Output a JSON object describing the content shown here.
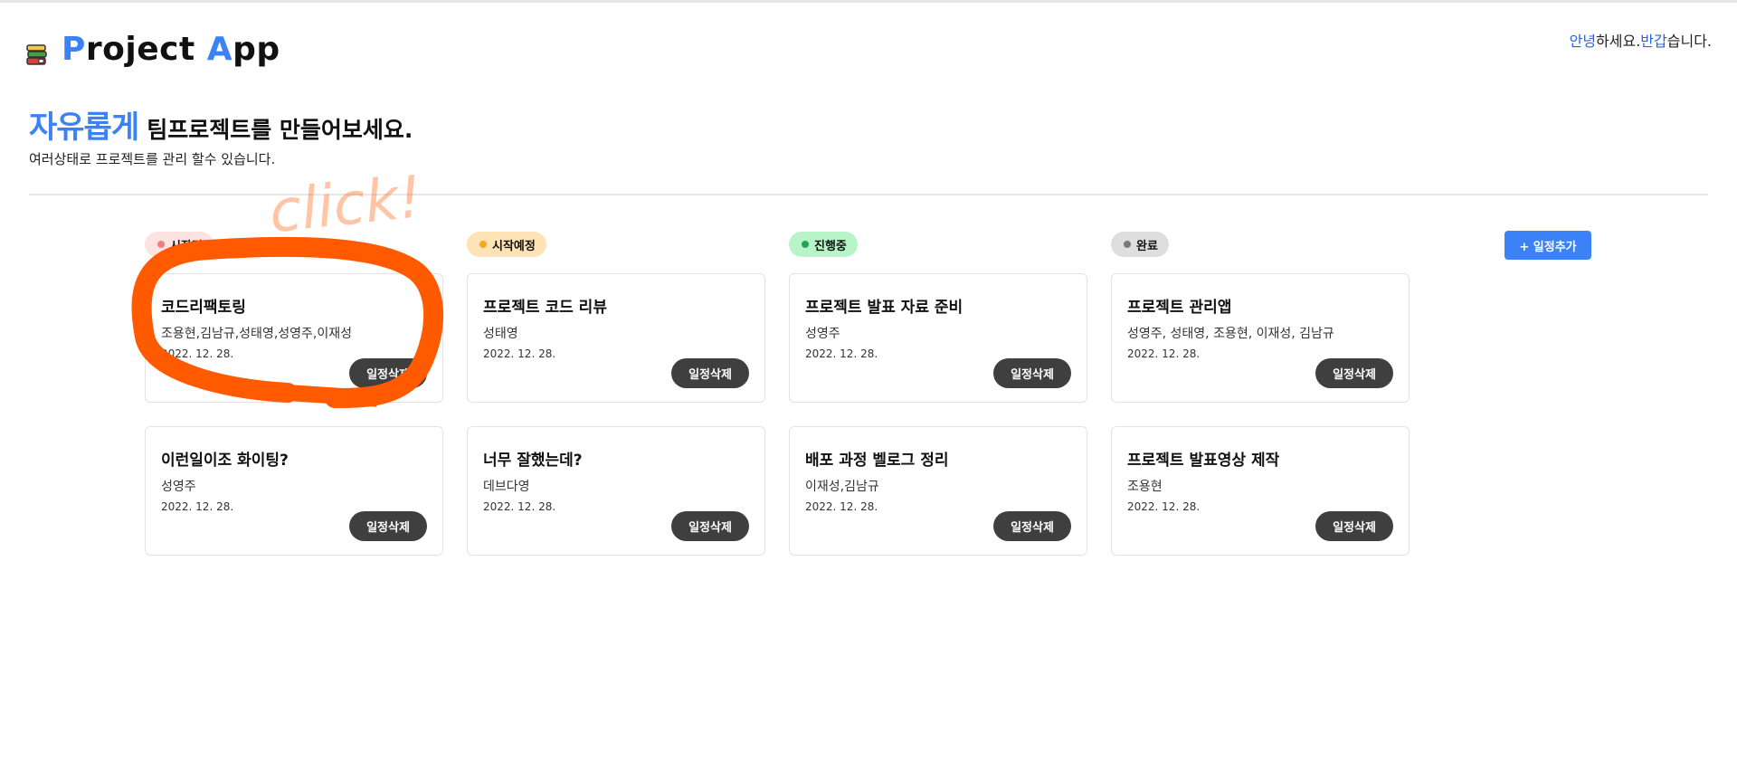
{
  "app": {
    "logo_prefix_accent": "P",
    "logo_part1": "roject ",
    "logo_accent2": "A",
    "logo_part2": "pp"
  },
  "header": {
    "greeting_hl1": "안녕",
    "greeting_t1": "하세요.",
    "greeting_hl2": "반갑",
    "greeting_t2": "습니다."
  },
  "hero": {
    "title_accent": "자유롭게",
    "title_rest": "팀프로젝트를 만들어보세요.",
    "subtitle": "여러상태로 프로젝트를 관리 할수 있습니다."
  },
  "annotation": {
    "text": "click!",
    "color": "#ff5a00"
  },
  "statuses": [
    {
      "label": "시작전",
      "bg": "#fde2e2",
      "dot": "#f08080"
    },
    {
      "label": "시작예정",
      "bg": "#fde3b6",
      "dot": "#f5a623"
    },
    {
      "label": "진행중",
      "bg": "#b7f5c9",
      "dot": "#22a559"
    },
    {
      "label": "완료",
      "bg": "#dedede",
      "dot": "#7a7a7a"
    }
  ],
  "add_button": {
    "label": "+ 일정추가"
  },
  "delete_label": "일정삭제",
  "cards": [
    {
      "title": "코드리팩토링",
      "members": "조용현,김남규,성태영,성영주,이재성",
      "date": "2022. 12. 28."
    },
    {
      "title": "프로젝트 코드 리뷰",
      "members": "성태영",
      "date": "2022. 12. 28."
    },
    {
      "title": "프로젝트 발표 자료 준비",
      "members": "성영주",
      "date": "2022. 12. 28."
    },
    {
      "title": "프로젝트 관리앱",
      "members": "성영주, 성태영, 조용현, 이재성, 김남규",
      "date": "2022. 12. 28."
    },
    {
      "title": "이런일이조 화이팅?",
      "members": "성영주",
      "date": "2022. 12. 28."
    },
    {
      "title": "너무 잘했는데?",
      "members": "데브다영",
      "date": "2022. 12. 28."
    },
    {
      "title": "배포 과정 벨로그 정리",
      "members": "이재성,김남규",
      "date": "2022. 12. 28."
    },
    {
      "title": "프로젝트 발표영상 제작",
      "members": "조용현",
      "date": "2022. 12. 28."
    }
  ]
}
